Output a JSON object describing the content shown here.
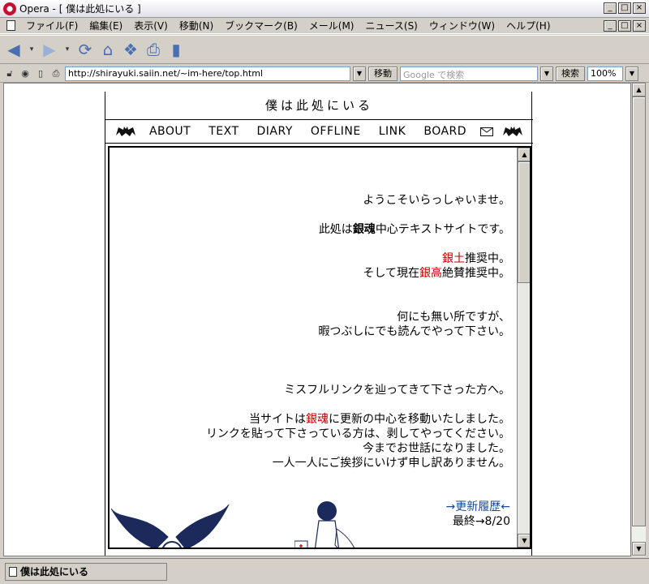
{
  "window": {
    "title": "Opera - [ 僕は此処にいる ]",
    "buttons": [
      "_",
      "□",
      "×"
    ]
  },
  "menu": {
    "items": [
      "ファイル(F)",
      "編集(E)",
      "表示(V)",
      "移動(N)",
      "ブックマーク(B)",
      "メール(M)",
      "ニュース(S)",
      "ウィンドウ(W)",
      "ヘルプ(H)"
    ]
  },
  "address": {
    "url": "http://shirayuki.saiin.net/~im-here/top.html",
    "go_label": "移動",
    "search_placeholder": "Google で検索",
    "search_label": "検索",
    "zoom": "100%"
  },
  "site": {
    "title": "僕は此処にいる",
    "nav": [
      "ABOUT",
      "TEXT",
      "DIARY",
      "OFFLINE",
      "LINK",
      "BOARD"
    ],
    "welcome": "ようこそいらっしゃいませ。",
    "intro_pre": "此処は",
    "intro_bold": "銀魂",
    "intro_post": "中心テキストサイトです。",
    "rec1_red": "銀土",
    "rec1_post": "推奨中。",
    "rec2_pre": "そして現在",
    "rec2_red": "銀高",
    "rec2_post": "絶賛推奨中。",
    "line_nothing": "何にも無い所ですが、",
    "line_read": "暇つぶしにでも読んでやって下さい。",
    "line_misfull": "ミスフルリンクを辿ってきて下さった方へ。",
    "moved_pre": "当サイトは",
    "moved_red": "銀魂",
    "moved_post": "に更新の中心を移動いたしました。",
    "line_link": "リンクを貼って下さっている方は、剥してやってください。",
    "line_thanks": "今までお世話になりました。",
    "line_sorry": "一人一人にご挨拶にいけず申し訳ありません。",
    "history": "→更新履歴←",
    "last_update": "最終→8/20"
  },
  "status": {
    "text": "僕は此処にいる"
  }
}
